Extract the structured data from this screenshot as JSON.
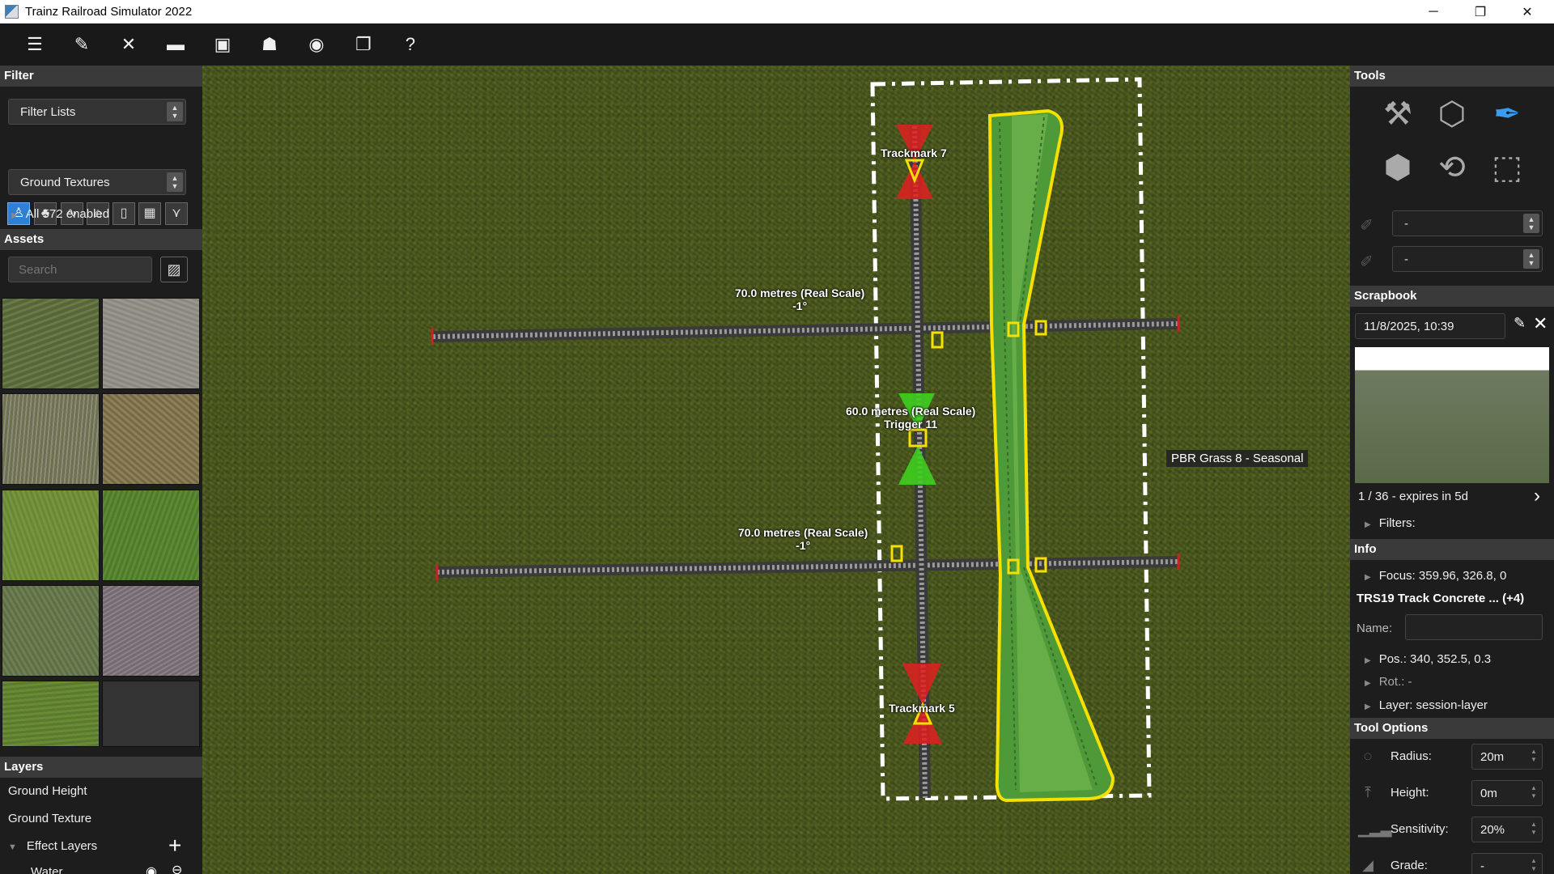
{
  "window": {
    "title": "Trainz Railroad Simulator 2022",
    "minimize": "─",
    "restore": "❐",
    "close": "✕"
  },
  "toolbar": {
    "icons": [
      "menu-icon",
      "edit-icon",
      "tools-icon",
      "monitor-icon",
      "camera-icon",
      "people-icon",
      "chat-icon",
      "windows-icon",
      "help-icon"
    ],
    "help_glyph": "?"
  },
  "left": {
    "filter_header": "Filter",
    "filter_lists": "Filter Lists",
    "filter_category": "Ground Textures",
    "enabled_text": "All 572 enabled",
    "assets_header": "Assets",
    "search_placeholder": "Search",
    "layers_header": "Layers",
    "layers": [
      "Ground Height",
      "Ground Texture",
      "Effect Layers",
      "Water"
    ]
  },
  "viewport": {
    "trackmark_top": "Trackmark 7",
    "trackmark_bottom": "Trackmark 5",
    "measure_top": "70.0 metres (Real Scale)",
    "measure_top_angle": "-1°",
    "measure_mid": "60.0 metres (Real Scale)",
    "trigger": "Trigger 11",
    "measure_bottom": "70.0 metres (Real Scale)",
    "measure_bottom_angle": "-1°",
    "tooltip": "PBR Grass 8 - Seasonal"
  },
  "right": {
    "tools_header": "Tools",
    "combo1": "-",
    "combo2": "-",
    "scrapbook_header": "Scrapbook",
    "scrapbook_date": "11/8/2025, 10:39",
    "scrapbook_count": "1 / 36  - expires in 5d",
    "filters_label": "Filters:",
    "info_header": "Info",
    "focus": "Focus: 359.96, 326.8, 0",
    "selected_asset": "TRS19 Track Concrete ... (+4)",
    "name_label": "Name:",
    "pos": "Pos.: 340, 352.5, 0.3",
    "rot": "Rot.: -",
    "layer": "Layer: session-layer",
    "tool_options_header": "Tool Options",
    "options": [
      {
        "label": "Radius:",
        "value": "20m"
      },
      {
        "label": "Height:",
        "value": "0m"
      },
      {
        "label": "Sensitivity:",
        "value": "20%"
      },
      {
        "label": "Grade:",
        "value": "-"
      }
    ]
  },
  "colors": {
    "accent": "#2f7fd6",
    "selection": "#f5e000",
    "trackmark": "#e02020",
    "trigger": "#3ecf1e"
  }
}
